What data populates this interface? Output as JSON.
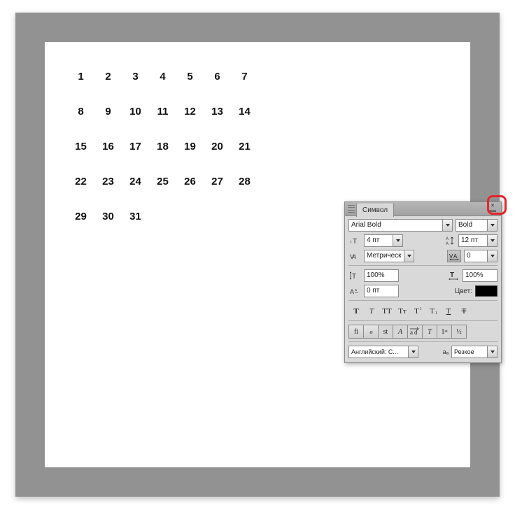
{
  "calendar": {
    "numbers": [
      [
        "1",
        "2",
        "3",
        "4",
        "5",
        "6",
        "7"
      ],
      [
        "8",
        "9",
        "10",
        "11",
        "12",
        "13",
        "14"
      ],
      [
        "15",
        "16",
        "17",
        "18",
        "19",
        "20",
        "21"
      ],
      [
        "22",
        "23",
        "24",
        "25",
        "26",
        "27",
        "28"
      ],
      [
        "29",
        "30",
        "31"
      ]
    ]
  },
  "panel": {
    "title": "Символ",
    "font_family": "Arial Bold",
    "font_style": "Bold",
    "font_size": "4 пт",
    "leading": "12 пт",
    "kerning": "Метрическ",
    "tracking": "0",
    "vscale": "100%",
    "hscale": "100%",
    "baseline": "0 пт",
    "color_label": "Цвет:",
    "color_value": "#000000",
    "styles": {
      "bold": "T",
      "italic": "T",
      "caps": "TT",
      "smallcaps": "Tᴛ",
      "sup": "T",
      "sub": "T",
      "underline": "T",
      "strike": "T"
    },
    "opentype": {
      "liga": "fi",
      "swsh": "ℴ",
      "titl": "st",
      "calt": "A",
      "ordn": "ad",
      "frac": "T",
      "onum": "1",
      "half": "½"
    },
    "language": "Английский: С...",
    "aa_icon": "aₐ",
    "antialias": "Резкое"
  }
}
